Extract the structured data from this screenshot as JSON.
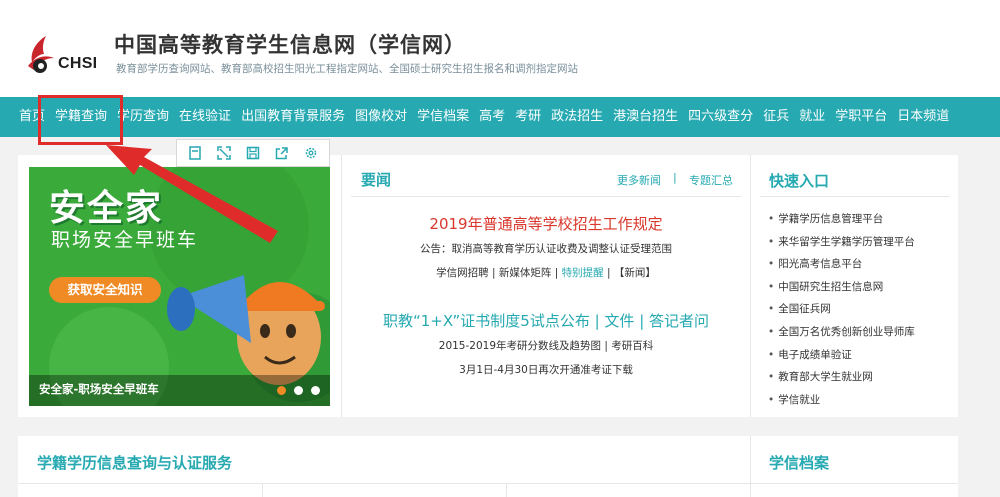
{
  "colors": {
    "accent": "#26a9b1",
    "headline_red": "#d9372b",
    "annotation_red": "#e02b2b",
    "banner_green": "#3aaa3a",
    "banner_orange": "#f08a24"
  },
  "header": {
    "logo_text": "CHSI",
    "title": "中国高等教育学生信息网（学信网）",
    "subtitle": "教育部学历查询网站、教育部高校招生阳光工程指定网站、全国硕士研究生招生报名和调剂指定网站"
  },
  "nav": {
    "items": [
      "首页",
      "学籍查询",
      "学历查询",
      "在线验证",
      "出国教育背景服务",
      "图像校对",
      "学信档案",
      "高考",
      "考研",
      "政法招生",
      "港澳台招生",
      "四六级查分",
      "征兵",
      "就业",
      "学职平台",
      "日本频道"
    ],
    "highlighted": "学籍查询"
  },
  "toolbar": {
    "icons": [
      "bookmark-icon",
      "expand-icon",
      "save-icon",
      "share-icon",
      "settings-icon"
    ]
  },
  "banner": {
    "title": "安全家",
    "subtitle": "职场安全早班车",
    "button": "获取安全知识",
    "caption": "安全家-职场安全早班车"
  },
  "news": {
    "title": "要闻",
    "more_link": "更多新闻",
    "separator": "|",
    "topics_link": "专题汇总",
    "headline_1": "2019年普通高等学校招生工作规定",
    "notice": "公告：取消高等教育学历认证收费及调整认证受理范围",
    "links_row": [
      "学信网招聘",
      "|",
      "新媒体矩阵",
      "|",
      "特别提醒",
      "|",
      "【新闻】"
    ],
    "headline_2": "职教“1+X”证书制度5试点公布 | 文件 | 答记者问",
    "line_5": "2015-2019年考研分数线及趋势图 | 考研百科",
    "line_6": "3月1日-4月30日再次开通准考证下载"
  },
  "quick_entry": {
    "title": "快速入口",
    "items": [
      "学籍学历信息管理平台",
      "来华留学生学籍学历管理平台",
      "阳光高考信息平台",
      "中国研究生招生信息网",
      "全国征兵网",
      "全国万名优秀创新创业导师库",
      "电子成绩单验证",
      "教育部大学生就业网",
      "学信就业"
    ]
  },
  "lower": {
    "left_title": "学籍学历信息查询与认证服务",
    "right_title": "学信档案"
  }
}
